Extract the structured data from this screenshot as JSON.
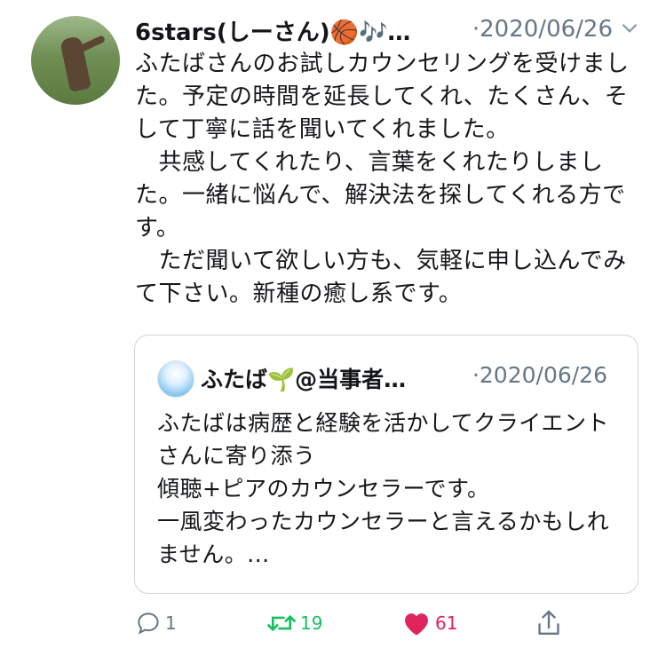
{
  "tweet": {
    "author_name": "6stars(しーさん)🏀🎶…",
    "date": "·2020/06/26",
    "text": "ふたばさんのお試しカウンセリングを受けました。予定の時間を延長してくれ、たくさん、そして丁寧に話を聞いてくれました。\n　共感してくれたり、言葉をくれたりしました。一緒に悩んで、解決法を探してくれる方です。\n　ただ聞いて欲しい方も、気軽に申し込んでみて下さい。新種の癒し系です。"
  },
  "quote": {
    "author_name": "ふたば🌱@当事者…",
    "date": "·2020/06/26",
    "text": "ふたばは病歴と経験を活かしてクライエントさんに寄り添う\n傾聴+ピアのカウンセラーです。\n一風変わったカウンセラーと言えるかもしれません。..."
  },
  "actions": {
    "reply_count": "1",
    "retweet_count": "19",
    "like_count": "61"
  },
  "icons": {
    "reply": "reply-icon",
    "retweet": "retweet-icon",
    "like": "heart-icon",
    "share": "share-icon",
    "menu": "chevron-down-icon"
  },
  "colors": {
    "retweet_active": "#17bf63",
    "like_active": "#e0245e",
    "muted": "#657786"
  }
}
